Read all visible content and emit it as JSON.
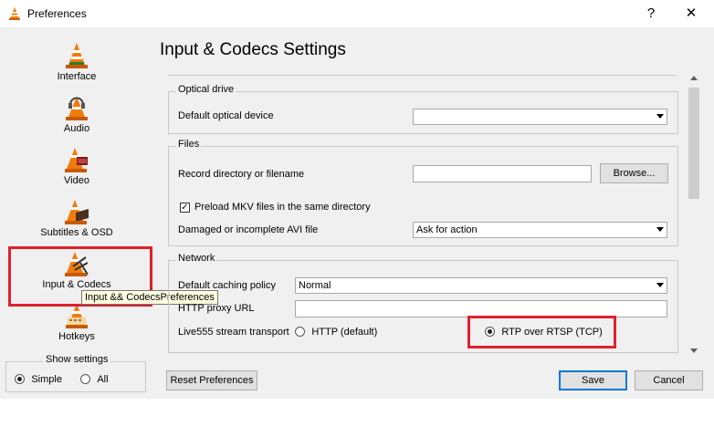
{
  "window": {
    "title": "Preferences",
    "help_glyph": "?",
    "close_glyph": "✕"
  },
  "sidebar": {
    "items": [
      {
        "label": "Interface",
        "icon": "cone-icon"
      },
      {
        "label": "Audio",
        "icon": "cone-headphones-icon"
      },
      {
        "label": "Video",
        "icon": "cone-film-icon"
      },
      {
        "label": "Subtitles & OSD",
        "icon": "cone-subtitles-icon"
      },
      {
        "label": "Input & Codecs",
        "icon": "cone-cable-icon",
        "selected": true
      },
      {
        "label": "Hotkeys",
        "icon": "cone-keyboard-icon"
      }
    ],
    "tooltip": "Input && CodecsPreferences",
    "show_settings": {
      "label": "Show settings",
      "simple": "Simple",
      "all": "All",
      "selected": "Simple"
    }
  },
  "page": {
    "title": "Input & Codecs Settings"
  },
  "optical": {
    "group": "Optical drive",
    "device_label": "Default optical device",
    "device_value": ""
  },
  "files": {
    "group": "Files",
    "record_label": "Record directory or filename",
    "record_value": "",
    "browse_label": "Browse...",
    "preload_label": "Preload MKV files in the same directory",
    "preload_checked": true,
    "avi_label": "Damaged or incomplete AVI file",
    "avi_value": "Ask for action"
  },
  "network": {
    "group": "Network",
    "caching_label": "Default caching policy",
    "caching_value": "Normal",
    "proxy_label": "HTTP proxy URL",
    "proxy_value": "",
    "transport_label": "Live555 stream transport",
    "http_option": "HTTP (default)",
    "rtp_option": "RTP over RTSP (TCP)",
    "selected_transport": "RTP over RTSP (TCP)"
  },
  "footer": {
    "reset_label": "Reset Preferences",
    "save_label": "Save",
    "cancel_label": "Cancel"
  },
  "colors": {
    "highlight": "#e0202c",
    "cone_orange": "#f07c0c",
    "focus_blue": "#0078d7"
  }
}
